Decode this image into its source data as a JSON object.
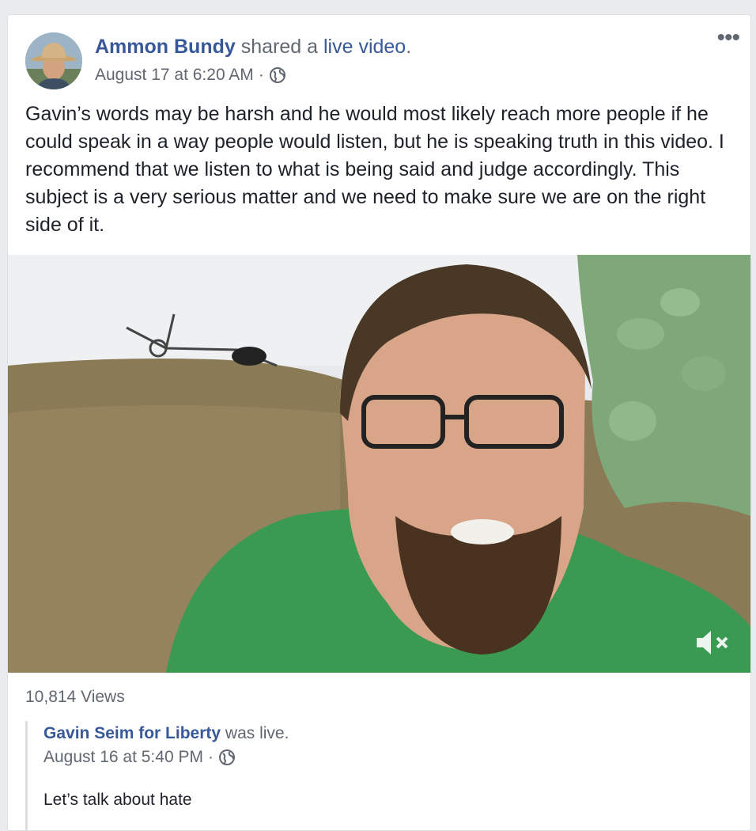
{
  "post": {
    "author": "Ammon Bundy",
    "action_prefix": "shared a",
    "action_link": "live video",
    "action_suffix": ".",
    "timestamp": "August 17 at 6:20 AM",
    "separator": "·",
    "privacy_icon": "globe-icon",
    "more_icon": "more-options-icon",
    "more_glyph": "•••",
    "text": "Gavin’s words may be harsh and he would most likely reach more people if he could speak in a way people would listen, but he is speaking truth in this video. I recommend that we listen to what is being said and judge accordingly. This subject is a very serious matter and we need to make sure we are on the right side of it."
  },
  "video": {
    "mute_icon": "speaker-muted-icon",
    "views": "10,814 Views"
  },
  "shared": {
    "author": "Gavin Seim for Liberty",
    "action": "was live.",
    "timestamp": "August 16 at 5:40 PM",
    "separator": "·",
    "privacy_icon": "globe-icon",
    "text": "Let’s talk about hate"
  },
  "colors": {
    "link": "#385898",
    "meta": "#606770",
    "text": "#1d2129",
    "background": "#e9ebee",
    "card": "#ffffff"
  }
}
